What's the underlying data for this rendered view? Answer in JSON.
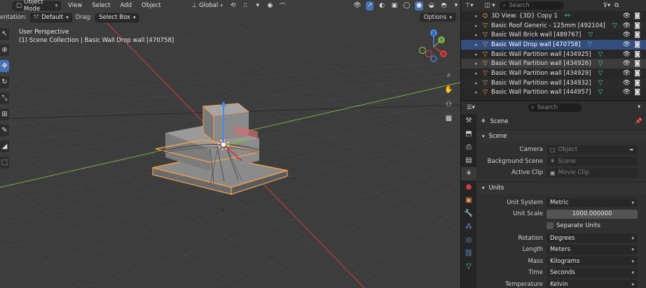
{
  "header": {
    "mode": "Object Mode",
    "menus": [
      "View",
      "Select",
      "Add",
      "Object"
    ],
    "transform_orientation": "Global"
  },
  "tool_settings": {
    "orientation_label": "entation:",
    "orientation_value": "Default",
    "drag_label": "Drag:",
    "drag_value": "Select Box",
    "options_label": "Options"
  },
  "viewport": {
    "perspective": "User Perspective",
    "collection_info": "(1) Scene Collection | Basic Wall Drop wall [470758]",
    "axis_x": "X",
    "axis_y": "Y",
    "axis_z": "Z"
  },
  "outliner": {
    "search_placeholder": "Search",
    "items": [
      {
        "name": "3D View: {3D} Copy 1",
        "state": "normal"
      },
      {
        "name": "Basic Roof Generic - 125mm [492104]",
        "state": "alt"
      },
      {
        "name": "Basic Wall Brick wall [489767]",
        "state": "normal"
      },
      {
        "name": "Basic Wall Drop wall [470758]",
        "state": "selected"
      },
      {
        "name": "Basic Wall Partition wall [434925]",
        "state": "normal"
      },
      {
        "name": "Basic Wall Partition wall [434926]",
        "state": "highlight"
      },
      {
        "name": "Basic Wall Partition wall [434929]",
        "state": "normal"
      },
      {
        "name": "Basic Wall Partition wall [434932]",
        "state": "alt"
      },
      {
        "name": "Basic Wall Partition wall [444957]",
        "state": "normal"
      }
    ]
  },
  "properties": {
    "search_placeholder": "Search",
    "context": "Scene",
    "scene_panel": {
      "title": "Scene",
      "camera_label": "Camera",
      "camera_placeholder": "Object",
      "background_label": "Background Scene",
      "background_placeholder": "Scene",
      "clip_label": "Active Clip",
      "clip_placeholder": "Movie Clip"
    },
    "units_panel": {
      "title": "Units",
      "unit_system_label": "Unit System",
      "unit_system": "Metric",
      "unit_scale_label": "Unit Scale",
      "unit_scale": "1000.000000",
      "separate_units": "Separate Units",
      "rotation_label": "Rotation",
      "rotation": "Degrees",
      "length_label": "Length",
      "length": "Meters",
      "mass_label": "Mass",
      "mass": "Kilograms",
      "time_label": "Time",
      "time": "Seconds",
      "temperature_label": "Temperature",
      "temperature": "Kelvin"
    }
  },
  "colors": {
    "accent": "#4772b3",
    "selection_orange": "#f0a050",
    "mesh_green": "#3fd1a0",
    "axis_red": "#c84040",
    "axis_green": "#7ab04a"
  }
}
